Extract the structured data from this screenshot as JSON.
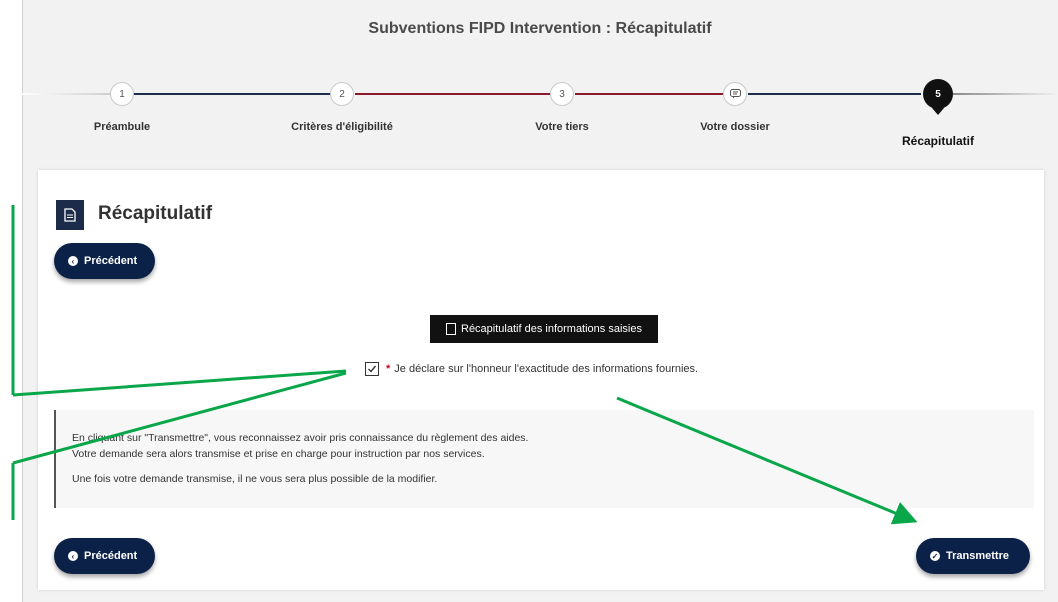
{
  "header": {
    "title": "Subventions FIPD Intervention : Récapitulatif"
  },
  "stepper": {
    "steps": [
      {
        "number": "1",
        "label": "Préambule"
      },
      {
        "number": "2",
        "label": "Critères d'éligibilité"
      },
      {
        "number": "3",
        "label": "Votre tiers"
      },
      {
        "number": "",
        "label": "Votre dossier",
        "icon": "chat-icon"
      },
      {
        "number": "5",
        "label": "Récapitulatif",
        "active": true
      }
    ]
  },
  "card": {
    "title": "Récapitulatif",
    "icon": "document-icon",
    "prev_label": "Précédent",
    "recap_button_label": "Récapitulatif des informations saisies",
    "declaration": {
      "checked": true,
      "required_mark": "*",
      "text": "Je déclare sur l'honneur l'exactitude des informations fournies."
    },
    "info": {
      "line1": "En cliquant sur \"Transmettre\", vous reconnaissez avoir pris connaissance du règlement des aides.",
      "line2": "Votre demande sera alors transmise et prise en charge pour instruction par nos services.",
      "line3": "Une fois votre demande transmise, il ne vous sera plus possible de la modifier."
    },
    "prev_bottom_label": "Précédent",
    "submit_label": "Transmettre"
  },
  "colors": {
    "primary": "#0b2148",
    "annotation": "#0aa64a",
    "step_line_red": "#8b1a2b",
    "step_line_navy": "#1c2b4a",
    "required": "#d0021b"
  }
}
